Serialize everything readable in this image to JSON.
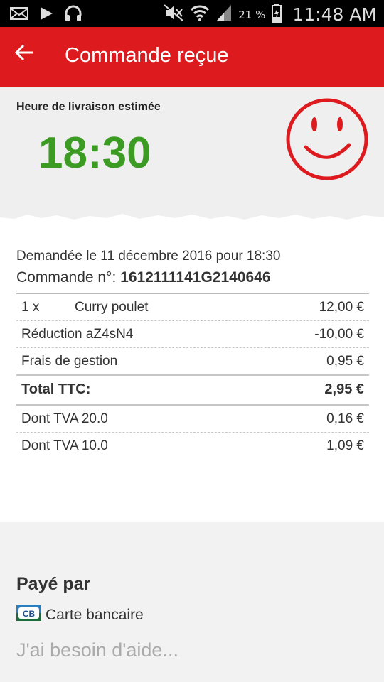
{
  "status_bar": {
    "icons": [
      "mail-icon",
      "play-icon",
      "headphones-icon",
      "mute-icon",
      "wifi-icon",
      "signal-icon",
      "battery-icon"
    ],
    "battery": "21 %",
    "time": "11:48 AM"
  },
  "header": {
    "title": "Commande reçue",
    "color": "#dd1a1e"
  },
  "delivery": {
    "label": "Heure de livraison estimée",
    "time": "18:30",
    "time_color": "#3b9b22",
    "smiley": "smiley-icon"
  },
  "order": {
    "requested": "Demandée le 11 décembre 2016 pour 18:30",
    "number_label": "Commande n°:",
    "number": "1612111141G2140646",
    "items": [
      {
        "qty": "1 x",
        "name": "Curry poulet",
        "price": "12,00 €"
      }
    ],
    "lines": [
      {
        "label": "Réduction aZ4sN4",
        "value": "-10,00 €"
      },
      {
        "label": "Frais de gestion",
        "value": "0,95 €"
      }
    ],
    "total": {
      "label": "Total TTC:",
      "value": "2,95 €"
    },
    "taxes": [
      {
        "label": "Dont TVA 20.0",
        "value": "0,16 €"
      },
      {
        "label": "Dont TVA 10.0",
        "value": "1,09 €"
      }
    ]
  },
  "payment": {
    "title": "Payé par",
    "method": "Carte bancaire",
    "logo_text": "CB"
  },
  "help": {
    "label": "J'ai besoin d'aide..."
  }
}
